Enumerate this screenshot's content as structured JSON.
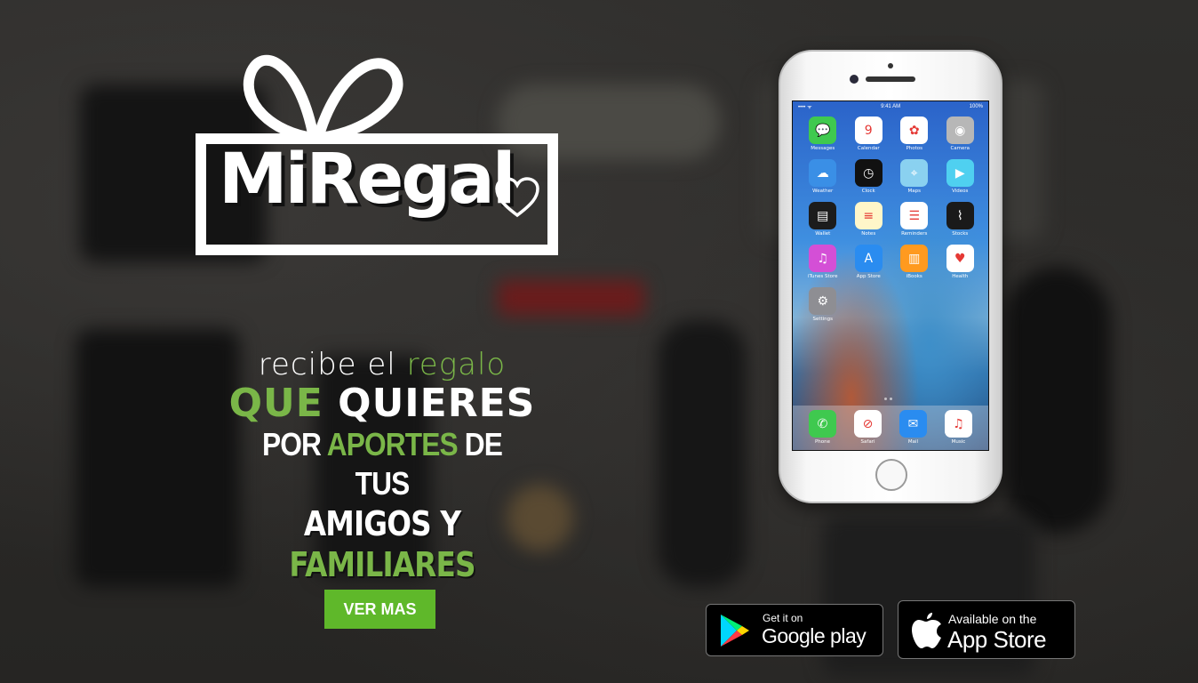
{
  "logo": {
    "text": "MiRegal",
    "heart_icon": "heart-icon",
    "bow_icon": "gift-bow-icon"
  },
  "tagline": {
    "line1_a": "recibe el",
    "line1_b": "regalo",
    "line2_a": "QUE",
    "line2_b": "QUIERES",
    "line3_a": "POR",
    "line3_b": "APORTES",
    "line3_c": "DE TUS",
    "line4_a": "AMIGOS Y",
    "line4_b": "FAMILIARES"
  },
  "cta": {
    "label": "VER MAS"
  },
  "colors": {
    "accent": "#7ab648",
    "button": "#5fb82a"
  },
  "phone": {
    "status": {
      "carrier": "•••• ᯤ",
      "time": "9:41 AM",
      "battery": "100%"
    },
    "apps": [
      {
        "label": "Messages",
        "icon": "messages-icon",
        "glyph": "💬",
        "bg": "#3fc94f"
      },
      {
        "label": "Calendar",
        "icon": "calendar-icon",
        "glyph": "9",
        "bg": "#ffffff"
      },
      {
        "label": "Photos",
        "icon": "photos-icon",
        "glyph": "✿",
        "bg": "#ffffff"
      },
      {
        "label": "Camera",
        "icon": "camera-icon",
        "glyph": "◉",
        "bg": "#b7b7b7"
      },
      {
        "label": "Weather",
        "icon": "weather-icon",
        "glyph": "☁",
        "bg": "#3a8fe6"
      },
      {
        "label": "Clock",
        "icon": "clock-icon",
        "glyph": "◷",
        "bg": "#111111"
      },
      {
        "label": "Maps",
        "icon": "maps-icon",
        "glyph": "⌖",
        "bg": "#8ad1f0"
      },
      {
        "label": "Videos",
        "icon": "videos-icon",
        "glyph": "▶",
        "bg": "#4fd0f0"
      },
      {
        "label": "Wallet",
        "icon": "wallet-icon",
        "glyph": "▤",
        "bg": "#1c1c1c"
      },
      {
        "label": "Notes",
        "icon": "notes-icon",
        "glyph": "≡",
        "bg": "#fff6c9"
      },
      {
        "label": "Reminders",
        "icon": "reminders-icon",
        "glyph": "☰",
        "bg": "#ffffff"
      },
      {
        "label": "Stocks",
        "icon": "stocks-icon",
        "glyph": "⌇",
        "bg": "#1a1a1a"
      },
      {
        "label": "iTunes Store",
        "icon": "itunes-icon",
        "glyph": "♫",
        "bg": "#d44fd6"
      },
      {
        "label": "App Store",
        "icon": "appstore-icon",
        "glyph": "A",
        "bg": "#2a8cf0"
      },
      {
        "label": "iBooks",
        "icon": "ibooks-icon",
        "glyph": "▥",
        "bg": "#ff9a1f"
      },
      {
        "label": "Health",
        "icon": "health-icon",
        "glyph": "♥",
        "bg": "#ffffff"
      },
      {
        "label": "Settings",
        "icon": "settings-icon",
        "glyph": "⚙",
        "bg": "#8e8e93"
      }
    ],
    "dock": [
      {
        "label": "Phone",
        "icon": "phone-icon",
        "glyph": "✆",
        "bg": "#3fc94f"
      },
      {
        "label": "Safari",
        "icon": "safari-icon",
        "glyph": "⊘",
        "bg": "#ffffff"
      },
      {
        "label": "Mail",
        "icon": "mail-icon",
        "glyph": "✉",
        "bg": "#2a8cf0"
      },
      {
        "label": "Music",
        "icon": "music-icon",
        "glyph": "♫",
        "bg": "#ffffff"
      }
    ]
  },
  "stores": {
    "google": {
      "small": "Get it on",
      "big": "Google play"
    },
    "apple": {
      "small": "Available on the",
      "big": "App Store"
    }
  }
}
